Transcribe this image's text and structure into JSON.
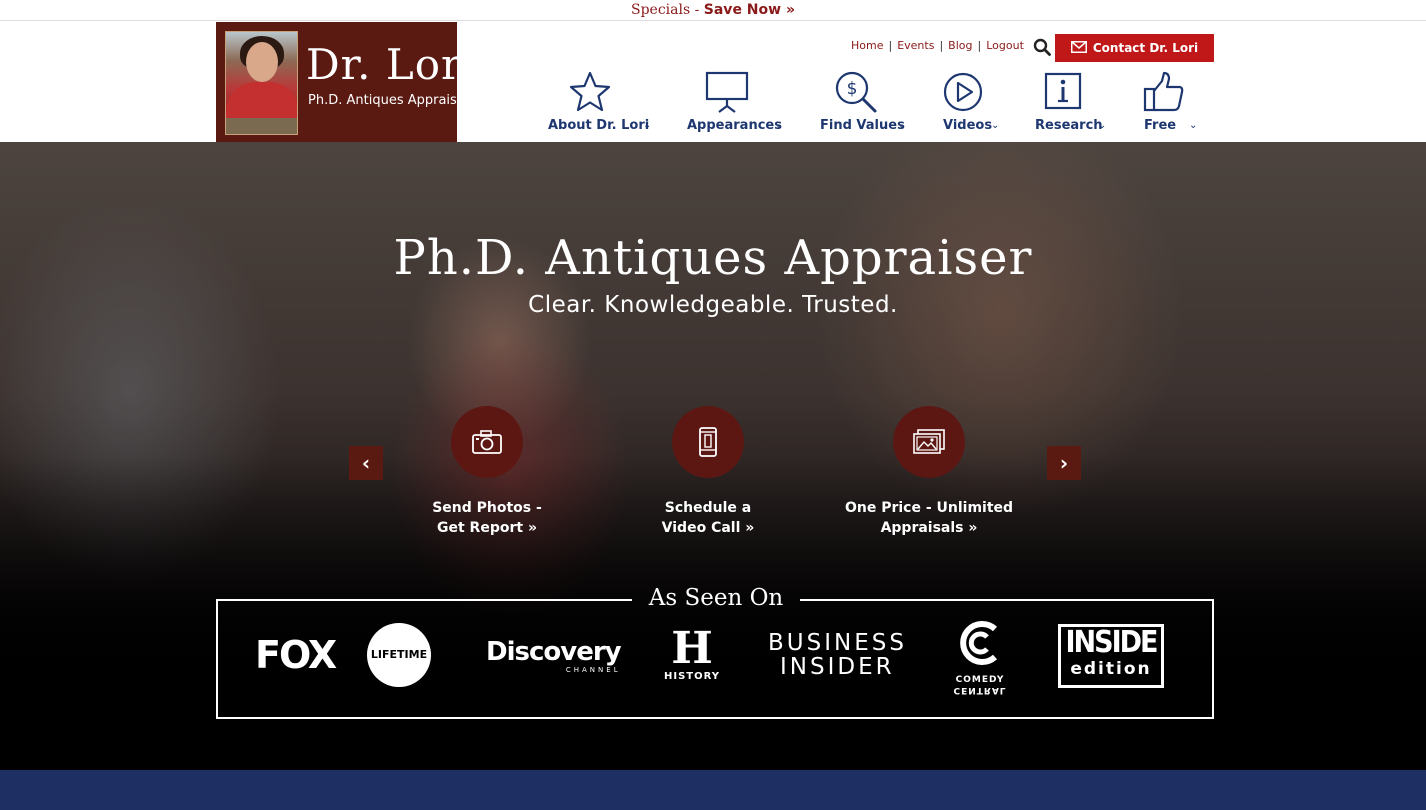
{
  "specials": {
    "prefix": "Specials - ",
    "cta": "Save Now »"
  },
  "logo": {
    "name": "Dr. Lori",
    "tagline": "Ph.D. Antiques Appraiser"
  },
  "utility_links": [
    "Home",
    "Events",
    "Blog",
    "Logout"
  ],
  "contact_button": "Contact Dr. Lori",
  "nav": [
    {
      "label": "About Dr. Lori",
      "icon": "star-icon"
    },
    {
      "label": "Appearances",
      "icon": "presentation-icon"
    },
    {
      "label": "Find Values",
      "icon": "dollar-search-icon"
    },
    {
      "label": "Videos",
      "icon": "play-icon"
    },
    {
      "label": "Research",
      "icon": "info-icon"
    },
    {
      "label": "Free",
      "icon": "thumbs-up-icon"
    }
  ],
  "hero": {
    "title": "Ph.D. Antiques Appraiser",
    "subtitle": "Clear. Knowledgeable. Trusted.",
    "features": [
      {
        "line1": "Send Photos -",
        "line2": "Get Report »",
        "icon": "camera-icon"
      },
      {
        "line1": "Schedule a",
        "line2": "Video Call »",
        "icon": "phone-icon"
      },
      {
        "line1": "One Price - Unlimited",
        "line2": "Appraisals »",
        "icon": "images-icon"
      }
    ]
  },
  "as_seen_on": {
    "title": "As Seen On",
    "brands": {
      "fox": "FOX",
      "lifetime": "LIFETIME",
      "discovery": "Discovery",
      "discovery_sub": "CHANNEL",
      "history_letter": "H",
      "history": "HISTORY",
      "business_1": "BUSINESS",
      "business_2": "INSIDER",
      "comedy_1": "COMEDY",
      "comedy_2": "CENTRAL",
      "inside_1": "INSIDE",
      "inside_2": "edition"
    }
  },
  "colors": {
    "brand_red": "#c01818",
    "logo_brown": "#5a1a12",
    "nav_blue": "#1e3770",
    "footer_blue": "#1e2f63"
  }
}
